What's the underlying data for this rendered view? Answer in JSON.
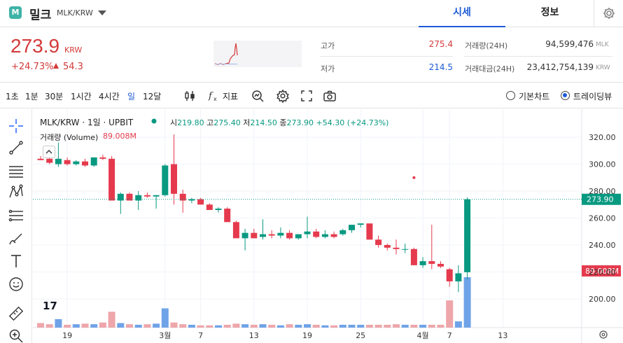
{
  "header": {
    "logo_letter": "M",
    "coin_name": "밀크",
    "pair": "MLK/KRW",
    "tabs": [
      {
        "label": "시세",
        "active": true
      },
      {
        "label": "정보",
        "active": false
      }
    ]
  },
  "price": {
    "current": "273.9",
    "unit": "KRW",
    "change_pct": "+24.73%",
    "change_abs": "54.3",
    "color_up": "#d33a3a"
  },
  "stats": {
    "high_label": "고가",
    "high_value": "275.4",
    "low_label": "저가",
    "low_value": "214.5",
    "volume_label": "거래량(24H)",
    "volume_value": "94,599,476",
    "volume_unit": "MLK",
    "turnover_label": "거래대금(24H)",
    "turnover_value": "23,412,754,139",
    "turnover_unit": "KRW"
  },
  "toolbar": {
    "timeframes": [
      "1초",
      "1분",
      "30분",
      "1시간",
      "4시간",
      "일",
      "12달"
    ],
    "active_timeframe": "일",
    "indicator_label": "지표",
    "chart_modes": [
      {
        "label": "기본차트",
        "selected": false
      },
      {
        "label": "트레이딩뷰",
        "selected": true
      }
    ]
  },
  "legend": {
    "symbol": "MLK/KRW · 1일 · UPBIT",
    "open_label": "시",
    "open_value": "219.80",
    "high_label": "고",
    "high_value": "275.40",
    "low_label": "저",
    "low_value": "214.50",
    "close_label": "종",
    "close_value": "273.90",
    "change_text": "+54.30 (+24.73%)",
    "volume_label": "거래량 (Volume)",
    "volume_value": "89.008M"
  },
  "tv_logo": "17",
  "chart_data": {
    "type": "candlestick",
    "up_color": "#089981",
    "down_color": "#e53a4d",
    "vol_up_color": "#6fa3e8",
    "vol_down_color": "#eea6aa",
    "y_ticks": [
      "320.00",
      "300.00",
      "280.00",
      "260.00",
      "240.00",
      "220.00",
      "200.00"
    ],
    "ylim": [
      180,
      325
    ],
    "x_labels": [
      {
        "label": "19",
        "index": 3
      },
      {
        "label": "3월",
        "index": 14
      },
      {
        "label": "7",
        "index": 18
      },
      {
        "label": "13",
        "index": 24
      },
      {
        "label": "19",
        "index": 30
      },
      {
        "label": "25",
        "index": 36
      },
      {
        "label": "4월",
        "index": 43
      },
      {
        "label": "7",
        "index": 46
      },
      {
        "label": "13",
        "index": 52
      }
    ],
    "last_price_label": "273.90",
    "last_price": 273.9,
    "last_volume_label": "89.008M",
    "marker_price": 290,
    "marker_index": 42,
    "candles": [
      [
        304,
        306,
        303,
        303
      ],
      [
        304,
        307,
        300,
        301
      ],
      [
        300,
        316,
        298,
        304
      ],
      [
        303,
        305,
        299,
        300
      ],
      [
        300,
        303,
        299,
        302
      ],
      [
        302,
        304,
        298,
        299
      ],
      [
        299,
        305,
        298,
        305
      ],
      [
        305,
        307,
        303,
        304
      ],
      [
        304,
        306,
        273,
        273
      ],
      [
        273,
        279,
        263,
        278
      ],
      [
        278,
        279,
        273,
        273
      ],
      [
        273,
        280,
        266,
        277
      ],
      [
        277,
        279,
        275,
        276
      ],
      [
        276,
        277,
        267,
        277
      ],
      [
        277,
        300,
        276,
        299
      ],
      [
        300,
        322,
        270,
        278
      ],
      [
        278,
        281,
        264,
        273
      ],
      [
        273,
        275,
        271,
        274
      ],
      [
        274,
        275,
        270,
        270
      ],
      [
        270,
        271,
        266,
        266
      ],
      [
        266,
        268,
        264,
        267
      ],
      [
        267,
        268,
        257,
        257
      ],
      [
        257,
        258,
        246,
        245
      ],
      [
        245,
        252,
        236,
        249
      ],
      [
        249,
        252,
        245,
        245
      ],
      [
        246,
        259,
        244,
        248
      ],
      [
        248,
        251,
        245,
        247
      ],
      [
        247,
        253,
        245,
        249
      ],
      [
        249,
        251,
        244,
        245
      ],
      [
        245,
        248,
        244,
        248
      ],
      [
        248,
        261,
        245,
        250
      ],
      [
        250,
        252,
        245,
        246
      ],
      [
        246,
        251,
        245,
        248
      ],
      [
        248,
        250,
        245,
        246
      ],
      [
        248,
        252,
        247,
        251
      ],
      [
        251,
        255,
        249,
        255
      ],
      [
        255,
        256,
        253,
        256
      ],
      [
        256,
        256,
        244,
        244
      ],
      [
        244,
        247,
        238,
        240
      ],
      [
        240,
        241,
        236,
        238
      ],
      [
        238,
        244,
        233,
        237
      ],
      [
        237,
        241,
        234,
        237
      ],
      [
        237,
        238,
        225,
        225
      ],
      [
        225,
        231,
        223,
        228
      ],
      [
        228,
        255,
        222,
        226
      ],
      [
        226,
        228,
        223,
        224
      ],
      [
        222,
        223,
        209,
        213
      ],
      [
        213,
        225,
        205,
        219
      ],
      [
        219.8,
        275.4,
        214.5,
        273.9
      ]
    ],
    "volumes": [
      0.8,
      0.6,
      1.5,
      0.5,
      0.6,
      0.7,
      0.6,
      0.9,
      2.8,
      0.8,
      0.6,
      0.5,
      0.6,
      0.7,
      3.4,
      0.9,
      0.6,
      0.5,
      0.4,
      0.4,
      0.4,
      0.5,
      0.7,
      0.6,
      0.5,
      0.6,
      0.5,
      0.4,
      0.6,
      0.5,
      0.6,
      0.5,
      0.4,
      0.4,
      0.5,
      0.5,
      0.5,
      0.5,
      0.5,
      0.5,
      0.6,
      0.5,
      0.5,
      0.5,
      0.5,
      0.5,
      4.8,
      1.1,
      8.9
    ]
  }
}
